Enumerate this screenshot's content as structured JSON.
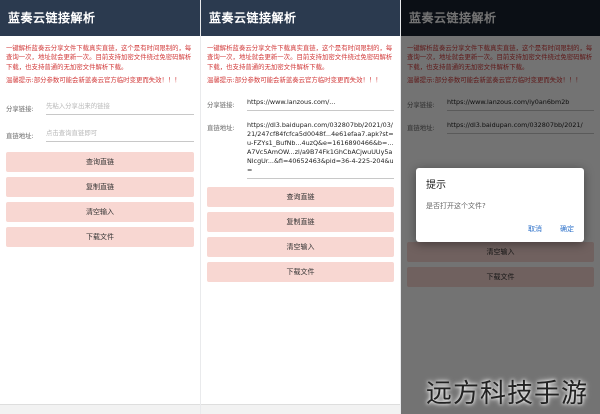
{
  "app_title": "蓝奏云链接解析",
  "description": "一键解析蓝奏云分享文件下载真实直链，这个是有时间限制的，每查询一次，地址就会更新一次。目前支持加密文件绕过免密码解析下载，也支持普通的无加密文件解析下载。",
  "warning": "温馨提示:部分参数可能会新蓝奏云官方临时变更而失效！！！",
  "share_label": "分享链接:",
  "share_placeholder": "先粘入分享出来的链接",
  "direct_label": "直链地址:",
  "direct_placeholder": "点击查询直链即可",
  "buttons": {
    "query": "查询直链",
    "copy": "复制直链",
    "clear": "清空输入",
    "download": "下载文件"
  },
  "screen2": {
    "share_value": "https://www.lanzous.com/...",
    "direct_value": "https://dl3.baidupan.com/032807bb/2021/03/21/247cf84fcfca5d0048f...4e61efaa7.apk?st=u-FZYs1_BufNb...4uzQ&e=1616890466&b=...A7Vc5AmOW...zl/a9B74Fk1GhCbACjwuUUy5aNlcgUr...&fi=40652463&pid=36-4-225-204&u="
  },
  "screen3": {
    "share_value": "https://www.lanzous.com/iy0an6bm2b",
    "direct_value": "https://dl3.baidupan.com/032807bb/2021/",
    "dialog": {
      "title": "提示",
      "message": "是否打开这个文件?",
      "cancel": "取消",
      "confirm": "确定"
    }
  },
  "watermark": "远方科技手游"
}
